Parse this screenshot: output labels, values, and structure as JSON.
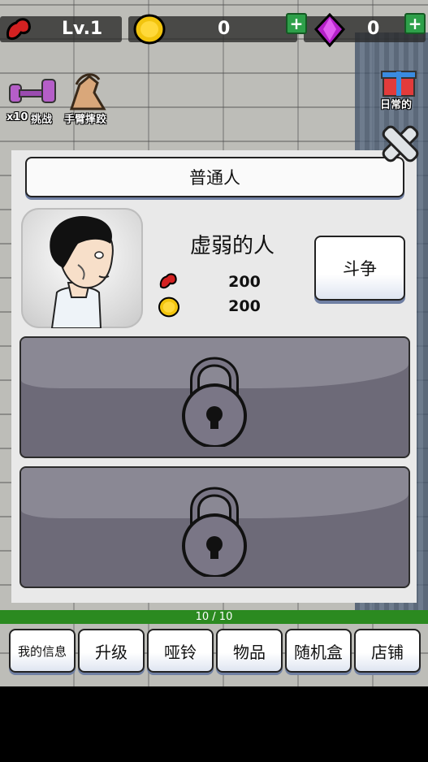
{
  "topbar": {
    "level": "Lv.1",
    "coins": "0",
    "gems": "0",
    "plus": "+"
  },
  "side": {
    "dumbbell_count": "x10",
    "challenge": "挑战",
    "arm_wrestling": "手臂摔跤",
    "daily": "日常的"
  },
  "modal": {
    "title": "普通人",
    "enemy_name": "虚弱的人",
    "strength": "200",
    "reward": "200",
    "fight": "斗争"
  },
  "progress": {
    "text": "10 / 10",
    "fraction": 1.0
  },
  "nav": [
    {
      "label": "我的信息"
    },
    {
      "label": "升级"
    },
    {
      "label": "哑铃"
    },
    {
      "label": "物品"
    },
    {
      "label": "随机盒"
    },
    {
      "label": "店铺"
    }
  ],
  "colors": {
    "xp_green": "#2b8a20",
    "button_shadow": "#6f7fa3",
    "locked_slot": "#6d6a78"
  }
}
